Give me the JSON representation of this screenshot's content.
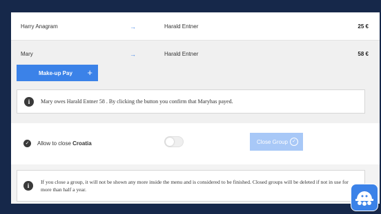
{
  "payments": [
    {
      "from": "Harry Anagram",
      "arrow": "→",
      "to": "Harald Entner",
      "amount": "25 €"
    },
    {
      "from": "Mary",
      "arrow": "→",
      "to": "Harald Entner",
      "amount": "58 €"
    }
  ],
  "makeup": {
    "label": "Make-up Pay",
    "plus": "+"
  },
  "info_icon": "i",
  "confirm_text": "Mary owes Harald Entner 58 . By clicking the button you confirm that Maryhas payed.",
  "close_group": {
    "allow_prefix": "Allow to close",
    "group_name": "Croatia",
    "toggle_on": false,
    "button_label": "Close Group",
    "check": "✓"
  },
  "close_info_text": "If you close a group, it will not be shown any more inside the menu and is considered to be finished. Closed groups will be deleted if not in use for more than half a year.",
  "colors": {
    "accent": "#3b82e8",
    "background": "#16284a",
    "disabled_button": "#a8c8f7"
  },
  "icons": {
    "arrow": "arrow-right-icon",
    "info": "info-icon",
    "check": "check-circle-icon",
    "app": "app-logo-icon"
  }
}
